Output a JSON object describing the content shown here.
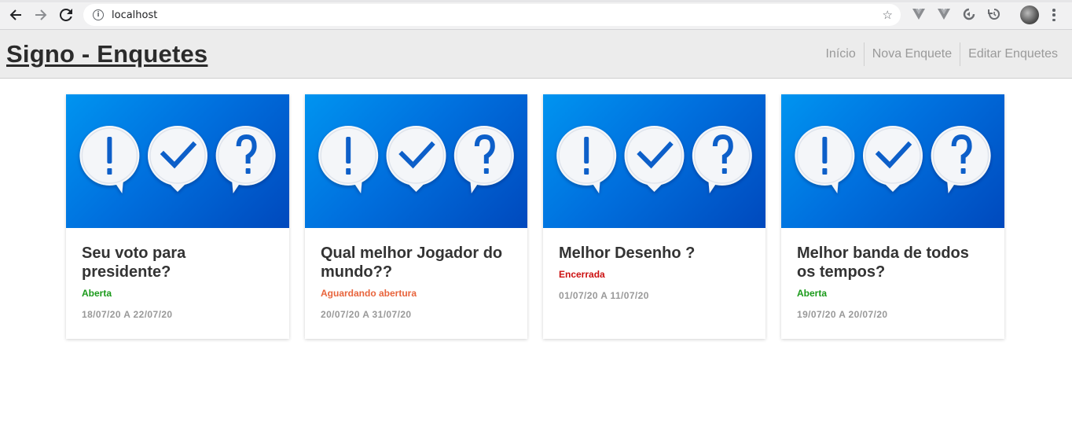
{
  "browser": {
    "url": "localhost",
    "icons": [
      "back-icon",
      "forward-icon",
      "reload-icon",
      "info-icon",
      "star-icon",
      "vue-devtools-icon",
      "vue-extension-icon",
      "extension-icon",
      "history-icon",
      "profile-avatar",
      "menu-icon"
    ]
  },
  "header": {
    "title": "Signo - Enquetes",
    "nav": [
      "Início",
      "Nova Enquete",
      "Editar Enquetes"
    ]
  },
  "colors": {
    "status_open": "#1a9a1a",
    "status_waiting": "#e8643c",
    "status_closed": "#cc1111",
    "card_gradient_start": "#0094f0",
    "card_gradient_end": "#0049bd"
  },
  "polls": [
    {
      "title": "Seu voto para presidente?",
      "status": "Aberta",
      "status_color": "#1a9a1a",
      "dates": "18/07/20 A 22/07/20"
    },
    {
      "title": "Qual melhor Jogador do mundo??",
      "status": "Aguardando abertura",
      "status_color": "#e8643c",
      "dates": "20/07/20 A 31/07/20"
    },
    {
      "title": "Melhor Desenho ?",
      "status": "Encerrada",
      "status_color": "#cc1111",
      "dates": "01/07/20 A 11/07/20"
    },
    {
      "title": "Melhor banda de todos os tempos?",
      "status": "Aberta",
      "status_color": "#1a9a1a",
      "dates": "19/07/20 A 20/07/20"
    }
  ]
}
